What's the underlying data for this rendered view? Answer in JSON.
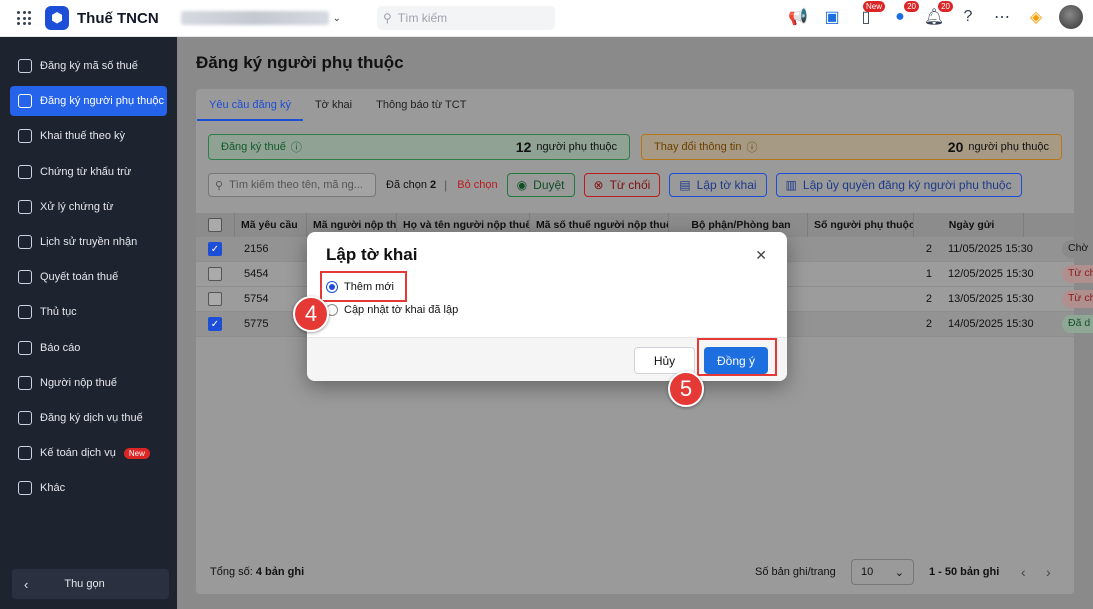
{
  "topbar": {
    "app_name": "Thuế TNCN",
    "search_placeholder": "Tìm kiếm",
    "badge_new": "New",
    "badge_chat": "20",
    "badge_notif": "20"
  },
  "sidebar": {
    "items": [
      {
        "label": "Đăng ký mã số thuế",
        "icon": "scan-icon"
      },
      {
        "label": "Đăng ký người phụ thuộc",
        "icon": "users-icon"
      },
      {
        "label": "Khai thuế theo kỳ",
        "icon": "document-icon"
      },
      {
        "label": "Chứng từ khấu trừ",
        "icon": "receipt-icon"
      },
      {
        "label": "Xử lý chứng từ",
        "icon": "check-doc-icon"
      },
      {
        "label": "Lịch sử truyền nhận",
        "icon": "transfer-icon"
      },
      {
        "label": "Quyết toán thuế",
        "icon": "settlement-icon"
      },
      {
        "label": "Thủ tục",
        "icon": "procedure-icon"
      },
      {
        "label": "Báo cáo",
        "icon": "chart-icon"
      },
      {
        "label": "Người nộp thuế",
        "icon": "person-icon"
      },
      {
        "label": "Đăng ký dịch vụ thuế",
        "icon": "service-icon"
      },
      {
        "label": "Kế toán dịch vụ",
        "icon": "accounting-icon",
        "tag": "New"
      },
      {
        "label": "Khác",
        "icon": "more-icon"
      }
    ],
    "active_index": 1,
    "collapse_label": "Thu gọn"
  },
  "page": {
    "title": "Đăng ký người phụ thuộc",
    "tabs": [
      "Yêu cầu đăng ký",
      "Tờ khai",
      "Thông báo từ TCT"
    ],
    "active_tab": 0
  },
  "stats": {
    "register": {
      "label": "Đăng ký thuế",
      "count": "12",
      "unit": "người phụ thuộc"
    },
    "change": {
      "label": "Thay đổi thông tin",
      "count": "20",
      "unit": "người phụ thuộc"
    }
  },
  "toolbar": {
    "search_placeholder": "Tìm kiếm theo tên, mã ng...",
    "selected_label": "Đã chọn",
    "selected_count": "2",
    "deselect": "Bỏ chọn",
    "approve": "Duyệt",
    "reject": "Từ chối",
    "make_declaration": "Lập tờ khai",
    "make_authorization": "Lập ủy quyền đăng ký người phụ thuộc"
  },
  "table": {
    "headers": [
      "Mã yêu cầu",
      "Mã người nộp thuế",
      "Họ và tên người nộp thuế",
      "Mã số thuế người nộp thuế",
      "Bộ phận/Phòng ban",
      "Số người phụ thuộc",
      "Ngày gửi"
    ],
    "rows": [
      {
        "code": "2156",
        "count": "2",
        "date": "11/05/2025 15:30",
        "status": "Chờ",
        "checked": true
      },
      {
        "code": "5454",
        "count": "1",
        "date": "12/05/2025 15:30",
        "status": "Từ ch",
        "checked": false
      },
      {
        "code": "5754",
        "count": "2",
        "date": "13/05/2025 15:30",
        "status": "Từ ch",
        "checked": false
      },
      {
        "code": "5775",
        "count": "2",
        "date": "14/05/2025 15:30",
        "status": "Đã d",
        "checked": true
      }
    ]
  },
  "footer": {
    "total_label": "Tổng số:",
    "total_value": "4 bản ghi",
    "per_page_label": "Số bản ghi/trang",
    "per_page": "10",
    "range": "1 - 50 bản ghi"
  },
  "modal": {
    "title": "Lập tờ khai",
    "options": [
      "Thêm mới",
      "Cập nhật tờ khai đã lập"
    ],
    "selected_option": 0,
    "cancel": "Hủy",
    "confirm": "Đồng ý"
  },
  "annotations": {
    "step4": "4",
    "step5": "5"
  },
  "colors": {
    "primary": "#1d6fe0",
    "highlight": "#e53935",
    "sidebar_bg": "#1e2330"
  }
}
